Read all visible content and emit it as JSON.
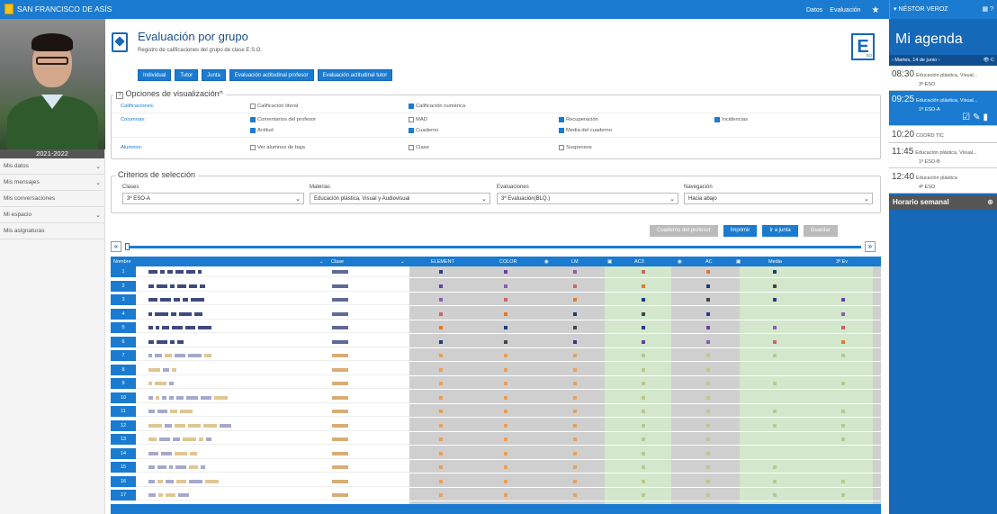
{
  "topbar": {
    "school": "SAN FRANCISCO DE ASÍS",
    "link_datos": "Datos",
    "link_evaluacion": "Evaluación",
    "user": "NÉSTOR VEROZ",
    "user_icons": "▦ ?"
  },
  "sidebar": {
    "year": "2021-2022",
    "items": [
      {
        "label": "Mis datos",
        "chevron": true
      },
      {
        "label": "Mis mensajes",
        "chevron": true
      },
      {
        "label": "Mis conversaciones",
        "chevron": false
      },
      {
        "label": "Mi espacio",
        "chevron": true
      },
      {
        "label": "Mis asignaturas",
        "chevron": false
      }
    ]
  },
  "header": {
    "title": "Evaluación por grupo",
    "subtitle": "Registro de calificaciones del grupo de clase E.S.O.",
    "logo_letter": "E",
    "logo_sub": "SO",
    "buttons": [
      "Individual",
      "Tutor",
      "Junta",
      "Evaluación actitudinal profesor",
      "Evaluación actitudinal tutor"
    ]
  },
  "options": {
    "legend": "Opciones de visualización",
    "calificaciones_label": "Calificaciones:",
    "columnas_label": "Columnas:",
    "alumnos_label": "Alumnos:",
    "calif_literal": "Calificación literal",
    "calif_numerica": "Calificación numérica",
    "comentarios": "Comentarios del profesor",
    "mad": "MAD",
    "recuperacion": "Recuperación",
    "incidencias": "Incidencias",
    "actitud": "Actitud",
    "cuaderno": "Cuaderno",
    "media_cuaderno": "Media del cuaderno",
    "ver_baja": "Ver alumnos de baja",
    "clase": "Clase",
    "suspensos": "Suspensos"
  },
  "criteria": {
    "legend": "Criterios de selección",
    "clases_label": "Clases",
    "clases_value": "3º ESO-A",
    "materias_label": "Materias",
    "materias_value": "Educación plástica, Visual y Audiovisual",
    "evaluaciones_label": "Evaluaciones",
    "evaluaciones_value": "3ª Evaluación(BLQ.)",
    "navegacion_label": "Navegación",
    "navegacion_value": "Hacia abajo"
  },
  "actions": {
    "cuaderno": "Cuaderno del profesor",
    "imprimir": "Imprimir",
    "junta": "Ir a junta",
    "guardar": "Guardar"
  },
  "slider": {
    "prev": "«",
    "next": "»"
  },
  "table": {
    "col_nombre": "Nombre",
    "col_clase": "Clase",
    "columns": [
      "ELEMENT",
      "COLOR",
      "LM",
      "AC3",
      "AC",
      "Media",
      "3ª Ev"
    ],
    "rows": [
      "1",
      "2",
      "3",
      "4",
      "5",
      "6",
      "7",
      "8",
      "9",
      "10",
      "11",
      "12",
      "13",
      "14",
      "15",
      "16",
      "17"
    ]
  },
  "agenda": {
    "title": "Mi agenda",
    "date": "‹ Martes, 14 de junio ›",
    "date_icons": "👁 C",
    "events": [
      {
        "time": "08:30",
        "desc": "Educación plástica, Visual...",
        "group": "3º ESO",
        "selected": false
      },
      {
        "time": "09:25",
        "desc": "Educación plástica, Visual...",
        "group": "1º ESO-A",
        "selected": true
      },
      {
        "time": "10:20",
        "desc": "COORD TIC",
        "group": "",
        "selected": false
      },
      {
        "time": "11:45",
        "desc": "Educación plástica, Visual...",
        "group": "1º ESO-B",
        "selected": false
      },
      {
        "time": "12:40",
        "desc": "Educación plástica",
        "group": "4º ESO",
        "selected": false
      }
    ],
    "weekly": "Horario semanal",
    "weekly_icon": "⊕"
  }
}
